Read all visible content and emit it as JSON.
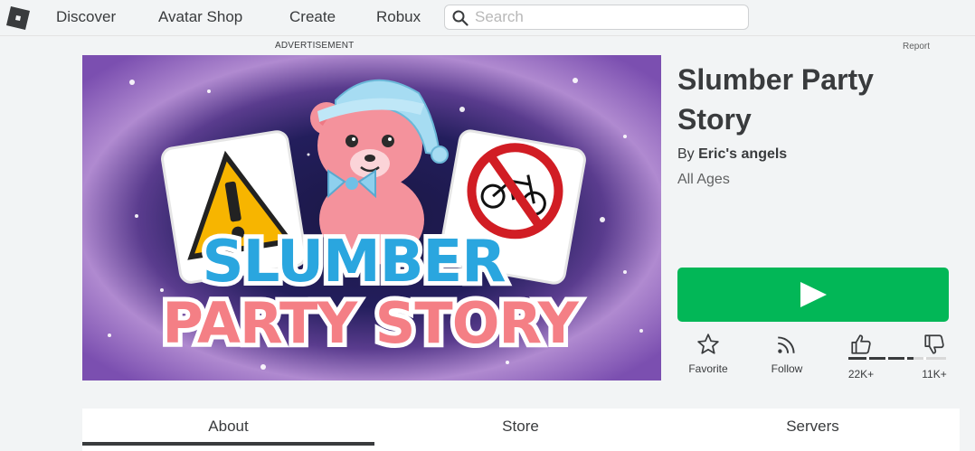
{
  "nav": {
    "items": [
      "Discover",
      "Avatar Shop",
      "Create",
      "Robux"
    ],
    "search_placeholder": "Search"
  },
  "ad": {
    "label": "ADVERTISEMENT",
    "report": "Report"
  },
  "thumbnail": {
    "line1": "SLUMBER",
    "line2": "PARTY STORY"
  },
  "game": {
    "title_line1": "Slumber Party",
    "title_line2": "Story",
    "by_prefix": "By",
    "creator": "Eric's angels",
    "age_rating": "All Ages"
  },
  "actions": {
    "favorite": "Favorite",
    "follow": "Follow",
    "upvotes": "22K+",
    "downvotes": "11K+",
    "upvote_fraction": 0.67
  },
  "tabs": [
    "About",
    "Store",
    "Servers"
  ],
  "colors": {
    "play": "#02b757",
    "text": "#393b3d",
    "background": "#f2f4f5"
  }
}
